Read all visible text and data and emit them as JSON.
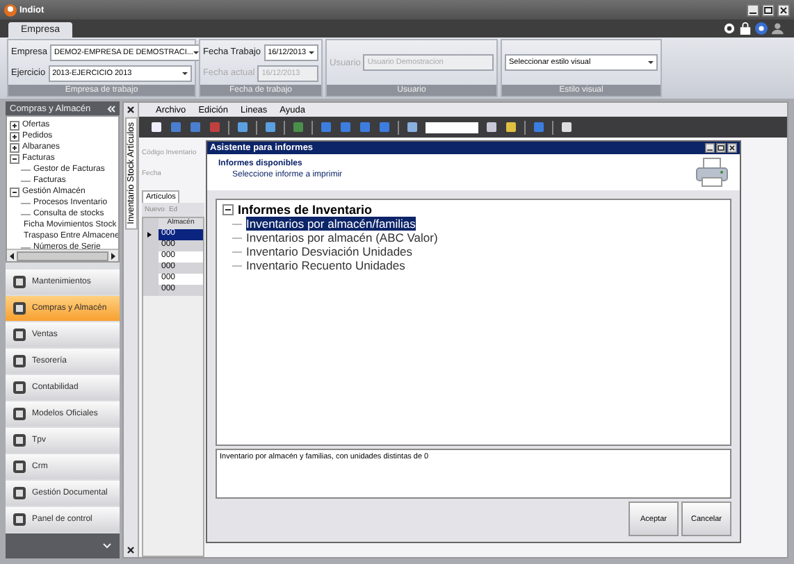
{
  "window": {
    "title": "Indiot"
  },
  "ribbon_tabs": [
    {
      "label": "Empresa",
      "selected": true
    }
  ],
  "ribbon_groups": [
    {
      "caption": "Empresa de trabajo",
      "fields": [
        {
          "label": "Empresa",
          "value": "DEMO2-EMPRESA DE DEMOSTRACI...",
          "kind": "combo",
          "disabled": false
        },
        {
          "label": "Ejercicio",
          "value": "2013-EJERCICIO 2013",
          "kind": "combo",
          "disabled": false
        }
      ]
    },
    {
      "caption": "Fecha de trabajo",
      "fields": [
        {
          "label": "Fecha Trabajo",
          "value": "16/12/2013",
          "kind": "combo",
          "disabled": false
        },
        {
          "label": "Fecha actual",
          "value": "16/12/2013",
          "kind": "text",
          "disabled": true
        }
      ]
    },
    {
      "caption": "Usuario",
      "fields": [
        {
          "label": "Usuario",
          "value": "Usuario Demostracion",
          "kind": "text",
          "disabled": true
        }
      ]
    },
    {
      "caption": "Estilo visual",
      "fields": [
        {
          "value": "Seleccionar estilo visual",
          "kind": "combo",
          "disabled": false
        }
      ]
    }
  ],
  "sidebar": {
    "title": "Compras y Almacén",
    "tree": [
      {
        "label": "Ofertas",
        "expanded": false
      },
      {
        "label": "Pedidos",
        "expanded": false
      },
      {
        "label": "Albaranes",
        "expanded": false
      },
      {
        "label": "Facturas",
        "expanded": true,
        "children": [
          {
            "label": "Gestor de Facturas"
          },
          {
            "label": "Facturas"
          }
        ]
      },
      {
        "label": "Gestión Almacén",
        "expanded": true,
        "children": [
          {
            "label": "Procesos Inventario"
          },
          {
            "label": "Consulta de stocks"
          },
          {
            "label": "Ficha Movimientos Stock"
          },
          {
            "label": "Traspaso Entre Almacene"
          },
          {
            "label": "Números de Serie"
          }
        ]
      }
    ],
    "modules": [
      {
        "label": "Mantenimientos",
        "selected": false
      },
      {
        "label": "Compras y Almacén",
        "selected": true
      },
      {
        "label": "Ventas",
        "selected": false
      },
      {
        "label": "Tesorería",
        "selected": false
      },
      {
        "label": "Contabilidad",
        "selected": false
      },
      {
        "label": "Modelos Oficiales",
        "selected": false
      },
      {
        "label": "Tpv",
        "selected": false
      },
      {
        "label": "Crm",
        "selected": false
      },
      {
        "label": "Gestión Documental",
        "selected": false
      },
      {
        "label": "Panel de control",
        "selected": false
      }
    ]
  },
  "document": {
    "tab_label": "Inventario Stock Artículos",
    "menu": [
      "Archivo",
      "Edición",
      "Lineas",
      "Ayuda"
    ],
    "form_labels": [
      "Código Inventario",
      "Fecha"
    ],
    "tabs": [
      {
        "label": "Artículos",
        "selected": true
      }
    ],
    "grid_toolbar": [
      "Nuevo",
      "Ed"
    ],
    "grid": {
      "columns": [
        "Almacén"
      ],
      "rows": [
        {
          "cells": [
            "000"
          ],
          "selected": true
        },
        {
          "cells": [
            "000"
          ],
          "selected": false
        },
        {
          "cells": [
            "000"
          ],
          "selected": false
        },
        {
          "cells": [
            "000"
          ],
          "selected": false
        },
        {
          "cells": [
            "000"
          ],
          "selected": false
        },
        {
          "cells": [
            "000"
          ],
          "selected": false
        }
      ]
    }
  },
  "dialog": {
    "title": "Asistente para informes",
    "heading": "Informes disponibles",
    "subheading": "Seleccione informe a imprimir",
    "tree": [
      {
        "label": "Informes de Inventario",
        "expanded": true,
        "children": [
          {
            "label": "Inventarios por almacén/familias",
            "selected": true
          },
          {
            "label": "Inventarios por almacén (ABC Valor)",
            "selected": false
          },
          {
            "label": "Inventario Desviación Unidades",
            "selected": false
          },
          {
            "label": "Inventario Recuento Unidades",
            "selected": false
          }
        ]
      }
    ],
    "description": "Inventario por almacén y familias, con unidades distintas de 0",
    "buttons": [
      "Aceptar",
      "Cancelar"
    ]
  }
}
